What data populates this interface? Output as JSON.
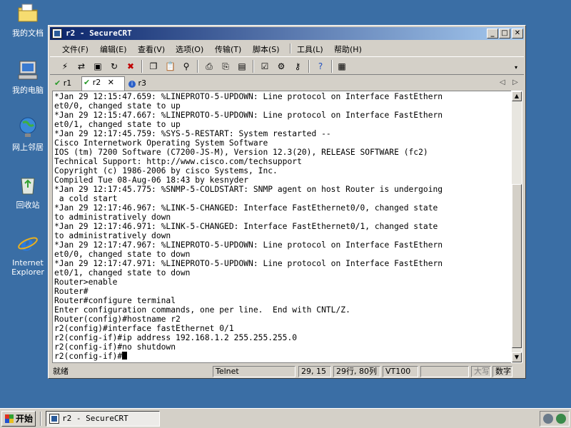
{
  "desktop": {
    "icons": [
      {
        "label": "我的文档",
        "icon": "folder-icon"
      },
      {
        "label": "我的电脑",
        "icon": "computer-icon"
      },
      {
        "label": "网上邻居",
        "icon": "network-icon"
      },
      {
        "label": "回收站",
        "icon": "recycle-bin-icon"
      },
      {
        "label": "Internet Explorer",
        "icon": "internet-explorer-icon"
      }
    ]
  },
  "window": {
    "title": "r2 - SecureCRT",
    "controls": {
      "minimize": "_",
      "maximize": "□",
      "close": "✕"
    },
    "menu": [
      "文件(F)",
      "编辑(E)",
      "查看(V)",
      "选项(O)",
      "传输(T)",
      "脚本(S)",
      "工具(L)",
      "帮助(H)"
    ],
    "tabs": [
      {
        "label": "r1",
        "state": "connected"
      },
      {
        "label": "r2",
        "state": "connected-active"
      },
      {
        "label": "r3",
        "state": "info"
      }
    ],
    "tab_close": "✕",
    "terminal": {
      "lines": [
        "*Jan 29 12:15:47.659: %LINEPROTO-5-UPDOWN: Line protocol on Interface FastEthern",
        "et0/0, changed state to up",
        "*Jan 29 12:15:47.667: %LINEPROTO-5-UPDOWN: Line protocol on Interface FastEthern",
        "et0/1, changed state to up",
        "*Jan 29 12:17:45.759: %SYS-5-RESTART: System restarted --",
        "Cisco Internetwork Operating System Software",
        "IOS (tm) 7200 Software (C7200-JS-M), Version 12.3(20), RELEASE SOFTWARE (fc2)",
        "Technical Support: http://www.cisco.com/techsupport",
        "Copyright (c) 1986-2006 by cisco Systems, Inc.",
        "Compiled Tue 08-Aug-06 18:43 by kesnyder",
        "*Jan 29 12:17:45.775: %SNMP-5-COLDSTART: SNMP agent on host Router is undergoing",
        " a cold start",
        "*Jan 29 12:17:46.967: %LINK-5-CHANGED: Interface FastEthernet0/0, changed state",
        "to administratively down",
        "*Jan 29 12:17:46.971: %LINK-5-CHANGED: Interface FastEthernet0/1, changed state",
        "to administratively down",
        "*Jan 29 12:17:47.967: %LINEPROTO-5-UPDOWN: Line protocol on Interface FastEthern",
        "et0/0, changed state to down",
        "*Jan 29 12:17:47.971: %LINEPROTO-5-UPDOWN: Line protocol on Interface FastEthern",
        "et0/1, changed state to down",
        "Router>enable",
        "Router#",
        "Router#configure terminal",
        "Enter configuration commands, one per line.  End with CNTL/Z.",
        "Router(config)#hostname r2",
        "r2(config)#interface fastEthernet 0/1",
        "r2(config-if)#ip address 192.168.1.2 255.255.255.0",
        "r2(config-if)#no shutdown"
      ],
      "prompt_line": "r2(config-if)#"
    },
    "status": {
      "ready": "就绪",
      "protocol": "Telnet",
      "cursor_pos": "29, 15",
      "size": "29行, 80列",
      "emulation": "VT100",
      "caps": "大写",
      "num": "数字"
    }
  },
  "taskbar": {
    "start_label": "开始",
    "task_label": "r2 - SecureCRT"
  }
}
